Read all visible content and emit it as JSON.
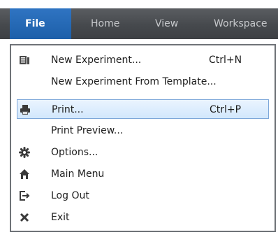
{
  "ribbon": {
    "tabs": [
      {
        "label": "File",
        "active": true
      },
      {
        "label": "Home"
      },
      {
        "label": "View"
      },
      {
        "label": "Workspace"
      }
    ]
  },
  "menu": {
    "items": [
      {
        "label": "New Experiment...",
        "shortcut": "Ctrl+N",
        "icon": "new-experiment-icon"
      },
      {
        "label": "New Experiment From Template...",
        "shortcut": ""
      },
      {
        "label": "Print...",
        "shortcut": "Ctrl+P",
        "icon": "printer-icon",
        "selected": true
      },
      {
        "label": "Print Preview...",
        "shortcut": ""
      },
      {
        "label": "Options...",
        "shortcut": "",
        "icon": "gear-icon"
      },
      {
        "label": "Main Menu",
        "shortcut": "",
        "icon": "home-icon"
      },
      {
        "label": "Log Out",
        "shortcut": "",
        "icon": "logout-icon"
      },
      {
        "label": "Exit",
        "shortcut": "",
        "icon": "close-x-icon"
      }
    ]
  },
  "colors": {
    "ribbon": "#46494d",
    "file_tab": "#1d5fa9",
    "selection": "#d2e7fc",
    "selection_border": "#7da7d9"
  }
}
